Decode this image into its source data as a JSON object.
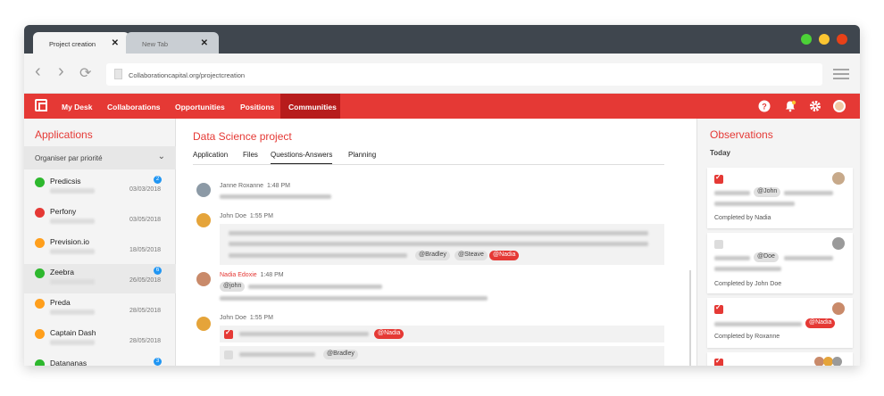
{
  "browser": {
    "tabs": [
      {
        "label": "Project creation"
      },
      {
        "label": "New Tab"
      }
    ],
    "url": "Collaborationcapital.org/projectcreation"
  },
  "nav": {
    "items": [
      "My Desk",
      "Collaborations",
      "Opportunities",
      "Positions",
      "Communities"
    ],
    "active": "Communities"
  },
  "left": {
    "title": "Applications",
    "sort_label": "Organiser par priorité",
    "apps": [
      {
        "name": "Predicsis",
        "date": "03/03/2018",
        "badge": "2",
        "color": "#2eb82e"
      },
      {
        "name": "Perfony",
        "date": "03/05/2018",
        "badge": "",
        "color": "#e53935"
      },
      {
        "name": "Prevision.io",
        "date": "18/05/2018",
        "badge": "",
        "color": "#ff9f1c"
      },
      {
        "name": "Zeebra",
        "date": "26/05/2018",
        "badge": "6",
        "color": "#2eb82e"
      },
      {
        "name": "Preda",
        "date": "28/05/2018",
        "badge": "",
        "color": "#ff9f1c"
      },
      {
        "name": "Captain Dash",
        "date": "28/05/2018",
        "badge": "",
        "color": "#ff9f1c"
      },
      {
        "name": "Datananas",
        "date": "",
        "badge": "3",
        "color": "#2eb82e"
      }
    ]
  },
  "main": {
    "title": "Data Science project",
    "tabs": [
      "Application",
      "Files",
      "Questions-Answers",
      "Planning"
    ],
    "active_tab": "Questions-Answers",
    "messages": [
      {
        "author": "Janne Roxanne",
        "time": "1:48 PM"
      },
      {
        "author": "John Doe",
        "time": "1:55 PM",
        "tags": [
          "@Bradley",
          "@Steave",
          "@Nadia"
        ]
      },
      {
        "author": "Nadia Edoxie",
        "time": "1:48 PM",
        "tags": [
          "@john"
        ]
      },
      {
        "author": "John Doe",
        "time": "1:55 PM",
        "tasks": [
          {
            "tag": "@Nadia"
          },
          {
            "tag": "@Bradley"
          }
        ]
      }
    ]
  },
  "right": {
    "title": "Observations",
    "today": "Today",
    "cards": [
      {
        "tag": "@John",
        "completed": "Completed by Nadia"
      },
      {
        "tag": "@Doe",
        "completed": "Completed by John Doe"
      },
      {
        "tag": "@Nadia",
        "completed": "Completed by Roxanne"
      }
    ]
  },
  "colors": {
    "accent": "#e53935",
    "accent_dark": "#b71c1c",
    "badge": "#2196f3"
  }
}
